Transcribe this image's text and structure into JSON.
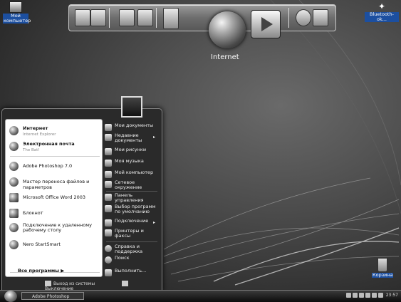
{
  "desktop": {
    "my_computer": "Мой компьютер",
    "bluetooth": "Bluetooth-ok...",
    "trash": "Корзина"
  },
  "dock": {
    "internet_label": "Internet"
  },
  "start_menu": {
    "pinned": [
      {
        "title": "Интернет",
        "sub": "Internet Explorer"
      },
      {
        "title": "Электронная почта",
        "sub": "The Bat!"
      }
    ],
    "recent": [
      "Adobe Photoshop 7.0",
      "Мастер переноса файлов и параметров",
      "Microsoft Office Word 2003",
      "Блокнот",
      "Подключение к удаленному рабочему столу",
      "Nero StartSmart"
    ],
    "all_programs": "Все программы",
    "right": [
      {
        "label": "Мои документы",
        "arrow": false
      },
      {
        "label": "Недавние документы",
        "arrow": true
      },
      {
        "label": "Мои рисунки",
        "arrow": false
      },
      {
        "label": "Моя музыка",
        "arrow": false
      },
      {
        "label": "Мой компьютер",
        "arrow": false
      },
      {
        "label": "Сетевое окружение",
        "arrow": false
      },
      {
        "label": "Панель управления",
        "arrow": false
      },
      {
        "label": "Выбор программ по умолчанию",
        "arrow": false
      },
      {
        "label": "Подключение",
        "arrow": true
      },
      {
        "label": "Принтеры и факсы",
        "arrow": false
      },
      {
        "label": "Справка и поддержка",
        "arrow": false
      },
      {
        "label": "Поиск",
        "arrow": false
      },
      {
        "label": "Выполнить...",
        "arrow": false
      }
    ],
    "logoff": "Выход из системы",
    "shutdown": "Выключение"
  },
  "taskbar": {
    "task": "Adobe Photoshop",
    "clock": "23:57"
  }
}
